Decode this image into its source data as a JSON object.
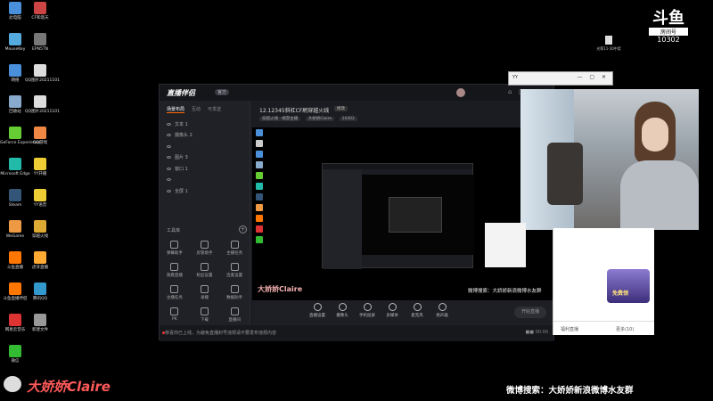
{
  "desktop": {
    "icons": [
      {
        "label": "此电脑",
        "color": "#4a8fd9"
      },
      {
        "label": "CF和谐天",
        "color": "#c44"
      },
      {
        "label": "MouseKey",
        "color": "#5ad"
      },
      {
        "label": "EPN5TN",
        "color": "#777"
      },
      {
        "label": "网络",
        "color": "#4a8fd9"
      },
      {
        "label": "QQ图片20211101",
        "color": "#ddd"
      },
      {
        "label": "回收站",
        "color": "#8ac"
      },
      {
        "label": "QQ图片20211101",
        "color": "#ddd"
      },
      {
        "label": "GeForce Experience",
        "color": "#6c3"
      },
      {
        "label": "QQ游戏",
        "color": "#e84"
      },
      {
        "label": "Microsoft Edge",
        "color": "#2ba"
      },
      {
        "label": "YY开播",
        "color": "#ec3"
      },
      {
        "label": "Steam",
        "color": "#357"
      },
      {
        "label": "YY语音",
        "color": "#ec3"
      },
      {
        "label": "WeGame",
        "color": "#e94"
      },
      {
        "label": "穿越火线",
        "color": "#da3"
      },
      {
        "label": "斗鱼直播",
        "color": "#f70"
      },
      {
        "label": "虎牙直播",
        "color": "#fa3"
      },
      {
        "label": "斗鱼直播伴侣",
        "color": "#f70"
      },
      {
        "label": "腾讯QQ",
        "color": "#39c"
      },
      {
        "label": "网易云音乐",
        "color": "#d33"
      },
      {
        "label": "新建文件",
        "color": "#999"
      },
      {
        "label": "微信",
        "color": "#3b3"
      }
    ],
    "file_label": "光荣11-10中奖"
  },
  "douyu": {
    "logo": "斗鱼",
    "room_label": "房间号",
    "room_number": "10302"
  },
  "app": {
    "brand": "直播伴侣",
    "version": "官方",
    "window_controls": [
      "⌂",
      "▢",
      "—",
      "✕"
    ],
    "left_tabs": [
      "场景布局",
      "互动",
      "可发送"
    ],
    "scenes": [
      "文本 1",
      "摄像头 2",
      "",
      "图片 3",
      "窗口 1",
      "",
      "全屏 1"
    ],
    "tools_header": "工具库",
    "tools": [
      "弹幕助手",
      "房管助手",
      "主播任务",
      "观看直播",
      "粉丝设置",
      "连麦设置",
      "主播任务",
      "录播",
      "数据助手",
      "PK",
      "下载",
      "直播间"
    ],
    "stream_title": "12.12345斜杠CF刷穿越火线",
    "stream_badge": "修改",
    "stream_meta": {
      "category": "穿越火线 · 端游主播",
      "streamer": "大娇娇Claire",
      "room": "10302"
    },
    "bottom_tools": [
      "直播设置",
      "摄像头",
      "手机投屏",
      "多媒体",
      "麦克风",
      "扬声器"
    ],
    "start_button": "开始直播",
    "status_message": "恭喜你已上线，为避免直播封号违规请不要发布违规内容",
    "status_right": "■■ 00:00"
  },
  "overlay": {
    "streamer_name_small": "大娇娇Claire",
    "weibo_small": "微博搜索：大娇娇新浪微博水友群"
  },
  "cam_window": {
    "title": "YY"
  },
  "white_panel": {
    "banner_text": "免费领",
    "footer_left": "福利直播",
    "footer_right": "更多(10)"
  },
  "footer": {
    "streamer_name": "大娇娇Claire",
    "weibo_text": "微博搜索：大娇娇新浪微博水友群"
  }
}
